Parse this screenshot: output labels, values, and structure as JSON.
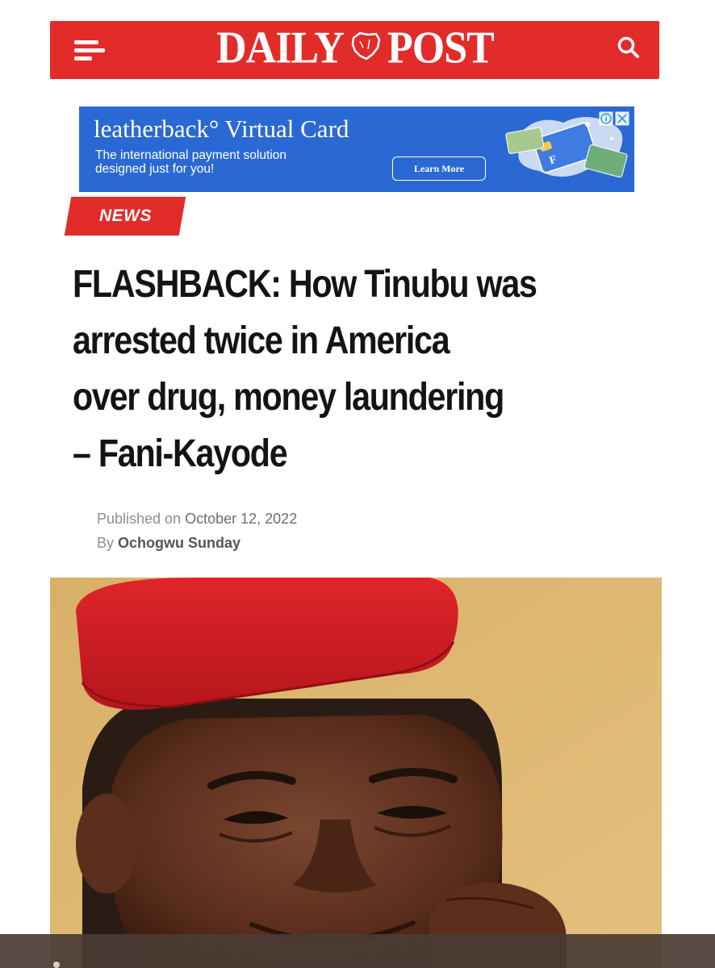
{
  "header": {
    "logo_left": "DAILY",
    "logo_right": "POST",
    "menu_icon": "hamburger-menu-icon",
    "search_icon": "search-icon",
    "brand_color": "#e22c29"
  },
  "ad": {
    "title": "leatherback° Virtual Card",
    "subtitle_line1": "The international payment solution",
    "subtitle_line2": "designed just for you!",
    "button_label": "Learn More",
    "background_color": "#2a69d3"
  },
  "article": {
    "category": "NEWS",
    "headline_line1": "FLASHBACK: How Tinubu was",
    "headline_line2": "arrested twice in America",
    "headline_line3": "over drug, money laundering",
    "headline_line4": "– Fani-Kayode",
    "published_label": "Published on",
    "published_date": "October 12, 2022",
    "by_label": "By",
    "author": "Ochogwu Sunday"
  }
}
